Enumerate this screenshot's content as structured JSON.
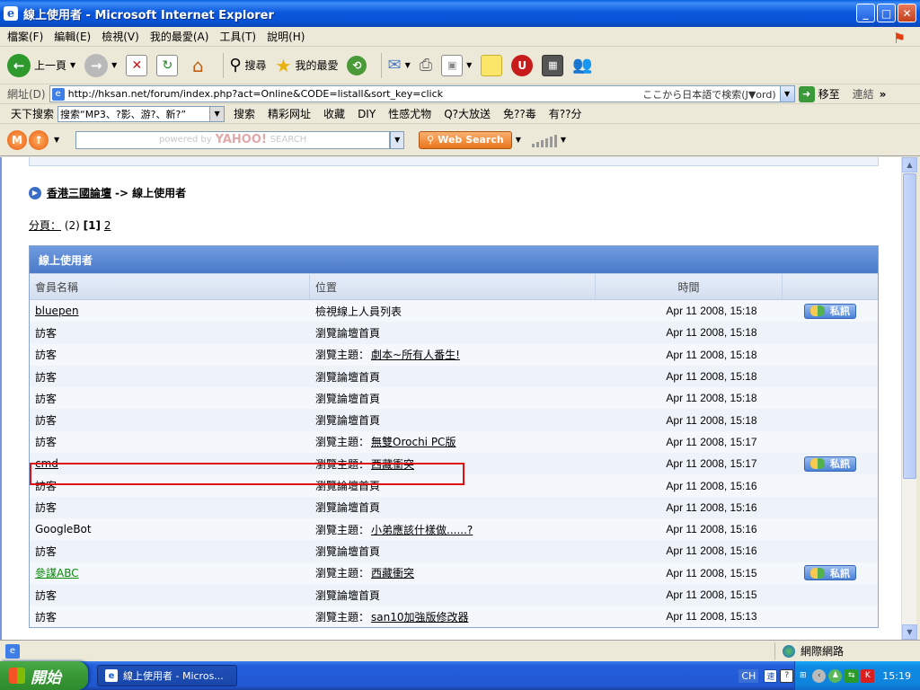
{
  "window": {
    "title": "線上使用者 - Microsoft Internet Explorer",
    "min": "_",
    "max": "□",
    "close": "✕"
  },
  "menu": [
    "檔案(F)",
    "編輯(E)",
    "檢視(V)",
    "我的最愛(A)",
    "工具(T)",
    "說明(H)"
  ],
  "toolbar": {
    "back": "上一頁",
    "search": "搜尋",
    "favorites": "我的最愛"
  },
  "address": {
    "label": "網址(D)",
    "url": "http://hksan.net/forum/index.php?act=Online&CODE=listall&sort_key=click",
    "jp_search": "ここから日本語で検索(J▼ord)",
    "go": "移至",
    "links": "連結"
  },
  "linksbar": {
    "items": [
      "天下搜索",
      "搜索“MP3、?影、游?、新?”",
      "搜索",
      "精彩网址",
      "收藏",
      "DIY",
      "性感尤物",
      "Q?大放送",
      "免??毒",
      "有??分"
    ]
  },
  "yahoo": {
    "powered": "powered by",
    "brand": "YAHOO!",
    "search_word": "SEARCH",
    "web_search": "Web Search"
  },
  "forum": {
    "breadcrumb_home": "香港三國論壇",
    "breadcrumb_sep": "->",
    "breadcrumb_current": "線上使用者",
    "pager_label": "分頁：",
    "pager_count": "(2)",
    "pager_current": "[1]",
    "pager_next": "2",
    "table_title": "線上使用者",
    "columns": [
      "會員名稱",
      "位置",
      "時間",
      ""
    ],
    "pm_label": "私訊",
    "rows": [
      {
        "member": "bluepen",
        "link": true,
        "location": "檢視線上人員列表",
        "topic": "",
        "time": "Apr 11 2008, 15:18",
        "pm": true
      },
      {
        "member": "訪客",
        "link": false,
        "location": "瀏覽論壇首頁",
        "topic": "",
        "time": "Apr 11 2008, 15:18",
        "pm": false
      },
      {
        "member": "訪客",
        "link": false,
        "location": "瀏覽主題：",
        "topic": "劇本~所有人番生!",
        "time": "Apr 11 2008, 15:18",
        "pm": false
      },
      {
        "member": "訪客",
        "link": false,
        "location": "瀏覽論壇首頁",
        "topic": "",
        "time": "Apr 11 2008, 15:18",
        "pm": false
      },
      {
        "member": "訪客",
        "link": false,
        "location": "瀏覽論壇首頁",
        "topic": "",
        "time": "Apr 11 2008, 15:18",
        "pm": false
      },
      {
        "member": "訪客",
        "link": false,
        "location": "瀏覽論壇首頁",
        "topic": "",
        "time": "Apr 11 2008, 15:18",
        "pm": false
      },
      {
        "member": "訪客",
        "link": false,
        "location": "瀏覽主題：",
        "topic": "無雙Orochi PC版",
        "time": "Apr 11 2008, 15:17",
        "pm": false
      },
      {
        "member": "cmd",
        "link": true,
        "location": "瀏覽主題：",
        "topic": "西藏衝突",
        "time": "Apr 11 2008, 15:17",
        "pm": true
      },
      {
        "member": "訪客",
        "link": false,
        "location": "瀏覽論壇首頁",
        "topic": "",
        "time": "Apr 11 2008, 15:16",
        "pm": false
      },
      {
        "member": "訪客",
        "link": false,
        "location": "瀏覽論壇首頁",
        "topic": "",
        "time": "Apr 11 2008, 15:16",
        "pm": false
      },
      {
        "member": "GoogleBot",
        "link": false,
        "location": "瀏覽主題：",
        "topic": "小弟應該什樣做......?",
        "time": "Apr 11 2008, 15:16",
        "pm": false
      },
      {
        "member": "訪客",
        "link": false,
        "location": "瀏覽論壇首頁",
        "topic": "",
        "time": "Apr 11 2008, 15:16",
        "pm": false
      },
      {
        "member": "參謀ABC",
        "link": true,
        "green": true,
        "location": "瀏覽主題：",
        "topic": "西藏衝突",
        "time": "Apr 11 2008, 15:15",
        "pm": true
      },
      {
        "member": "訪客",
        "link": false,
        "location": "瀏覽論壇首頁",
        "topic": "",
        "time": "Apr 11 2008, 15:15",
        "pm": false
      },
      {
        "member": "訪客",
        "link": false,
        "location": "瀏覽主題：",
        "topic": "san10加強版修改器",
        "time": "Apr 11 2008, 15:13",
        "pm": false
      }
    ]
  },
  "status": {
    "zone": "網際網路"
  },
  "taskbar": {
    "start": "開始",
    "task": "線上使用者 - Micros...",
    "lang": "CH",
    "clock": "15:19"
  }
}
